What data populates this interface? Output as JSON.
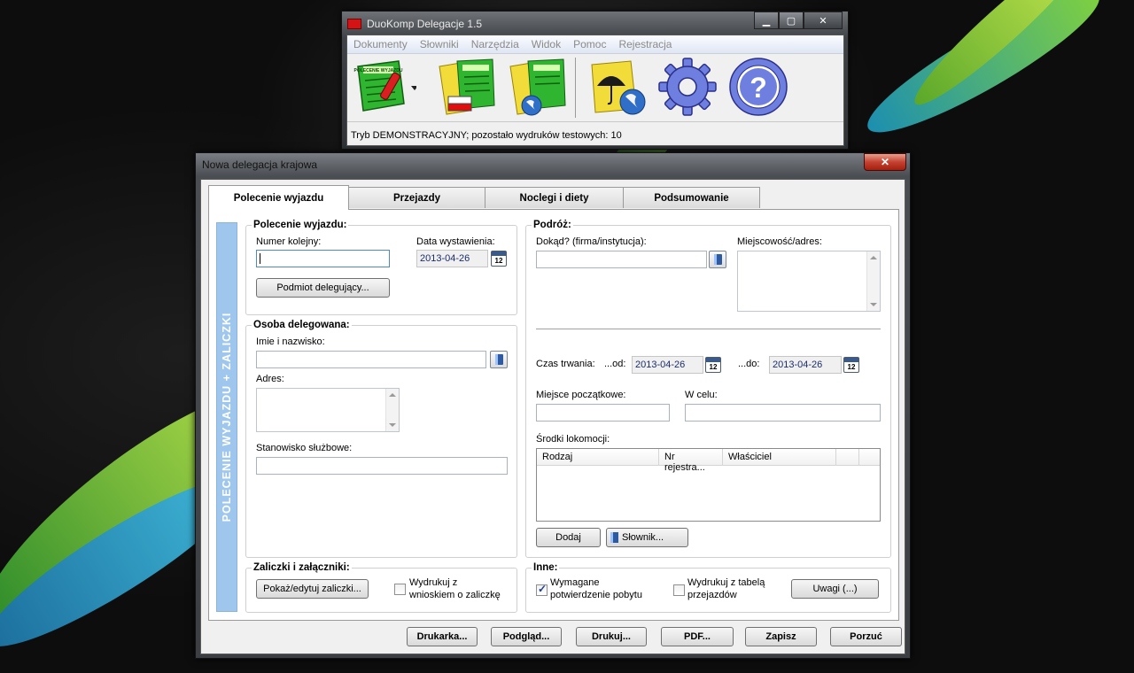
{
  "app": {
    "title": "DuoKomp Delegacje 1.5",
    "menu": [
      "Dokumenty",
      "Słowniki",
      "Narzędzia",
      "Widok",
      "Pomoc",
      "Rejestracja"
    ],
    "toolbar_icon_text": "POLECENIE WYJAZDU",
    "status": "Tryb DEMONSTRACYJNY; pozostało wydruków testowych: 10"
  },
  "dialog": {
    "title": "Nowa delegacja krajowa",
    "tabs": [
      "Polecenie wyjazdu",
      "Przejazdy",
      "Noclegi i diety",
      "Podsumowanie"
    ],
    "side_label": "POLECENIE WYJAZDU + ZALICZKI",
    "polecenie": {
      "legend": "Polecenie wyjazdu:",
      "numer_label": "Numer kolejny:",
      "numer_value": "",
      "data_label": "Data wystawienia:",
      "data_value": "2013-04-26",
      "podmiot_button": "Podmiot delegujący..."
    },
    "osoba": {
      "legend": "Osoba delegowana:",
      "imie_label": "Imie i nazwisko:",
      "adres_label": "Adres:",
      "stanowisko_label": "Stanowisko służbowe:"
    },
    "zaliczki": {
      "legend": "Zaliczki i załączniki:",
      "edit_button": "Pokaż/edytuj zaliczki...",
      "print_check_label_1": "Wydrukuj z",
      "print_check_label_2": "wnioskiem o zaliczkę"
    },
    "podroz": {
      "legend": "Podróż:",
      "dokad_label": "Dokąd? (firma/instytucja):",
      "miejscowosc_label": "Miejscowość/adres:",
      "czas_label": "Czas trwania:",
      "od_label": "...od:",
      "od_value": "2013-04-26",
      "do_label": "...do:",
      "do_value": "2013-04-26",
      "miejsce_label": "Miejsce początkowe:",
      "cel_label": "W celu:",
      "srodki_label": "Środki lokomocji:",
      "columns": [
        "Rodzaj",
        "Nr rejestra...",
        "Właściciel"
      ],
      "dodaj_button": "Dodaj",
      "slownik_button": "Słownik..."
    },
    "inne": {
      "legend": "Inne:",
      "potw_label_1": "Wymagane",
      "potw_label_2": "potwierdzenie pobytu",
      "potw_checked": true,
      "tabela_label_1": "Wydrukuj z tabelą",
      "tabela_label_2": "przejazdów",
      "tabela_checked": false,
      "uwagi_button": "Uwagi (...)"
    },
    "bottom_buttons": [
      "Drukarka...",
      "Podgląd...",
      "Drukuj...",
      "PDF...",
      "Zapisz",
      "Porzuć"
    ]
  }
}
